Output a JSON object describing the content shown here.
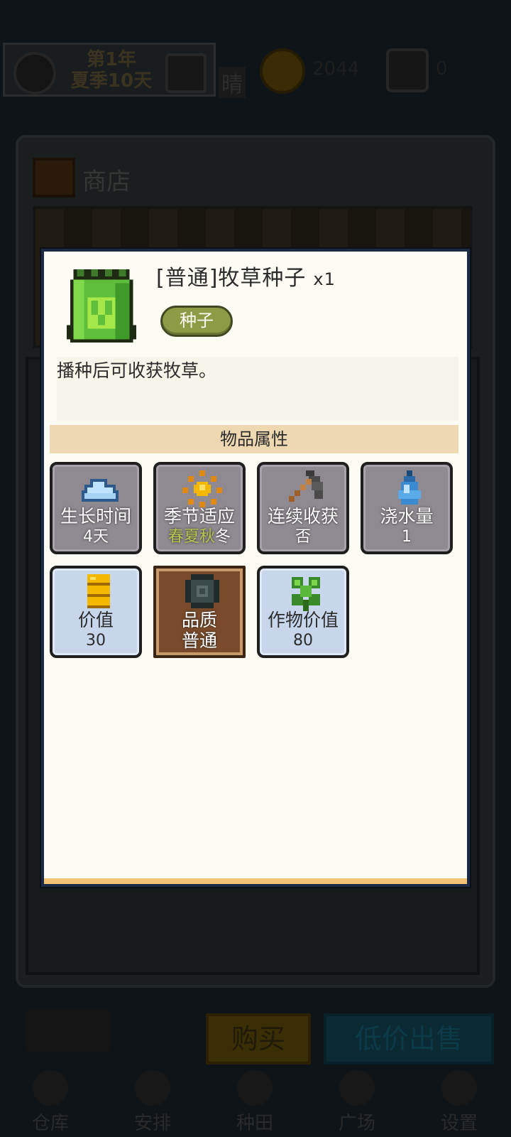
{
  "hud": {
    "date_line1": "第1年",
    "date_line2": "夏季10天",
    "weather": "晴",
    "coins": "2044",
    "gems": "0"
  },
  "shop": {
    "title": "商店",
    "buy_label": "购买",
    "sell_label": "低价出售"
  },
  "nav": {
    "items": [
      {
        "label": "仓库"
      },
      {
        "label": "安排"
      },
      {
        "label": "种田"
      },
      {
        "label": "广场"
      },
      {
        "label": "设置"
      }
    ]
  },
  "item": {
    "name": "[普通]牧草种子",
    "qty": "x1",
    "tag": "种子",
    "description": "播种后可收获牧草。",
    "attr_header": "物品属性",
    "attributes": [
      {
        "label": "生长时间",
        "value": "4天",
        "icon": "cloud-icon"
      },
      {
        "label": "季节适应",
        "seasons_on": "春夏秋",
        "seasons_off": "冬",
        "icon": "sun-icon"
      },
      {
        "label": "连续收获",
        "value": "否",
        "icon": "scythe-icon"
      },
      {
        "label": "浇水量",
        "value": "1",
        "icon": "water-drop-icon"
      },
      {
        "label": "价值",
        "value": "30",
        "icon": "coin-stack-icon"
      },
      {
        "label": "品质",
        "value": "普通",
        "icon": "quality-badge-icon"
      },
      {
        "label": "作物价值",
        "value": "80",
        "icon": "clover-icon"
      }
    ]
  },
  "colors": {
    "modal_bg": "#fdfcf4",
    "tag_green": "#8d9a46",
    "card_gray": "#8f8a91",
    "card_blue": "#c8d6ec",
    "quality_brown": "#7a4b2a",
    "header_tan": "#eed8b2"
  }
}
